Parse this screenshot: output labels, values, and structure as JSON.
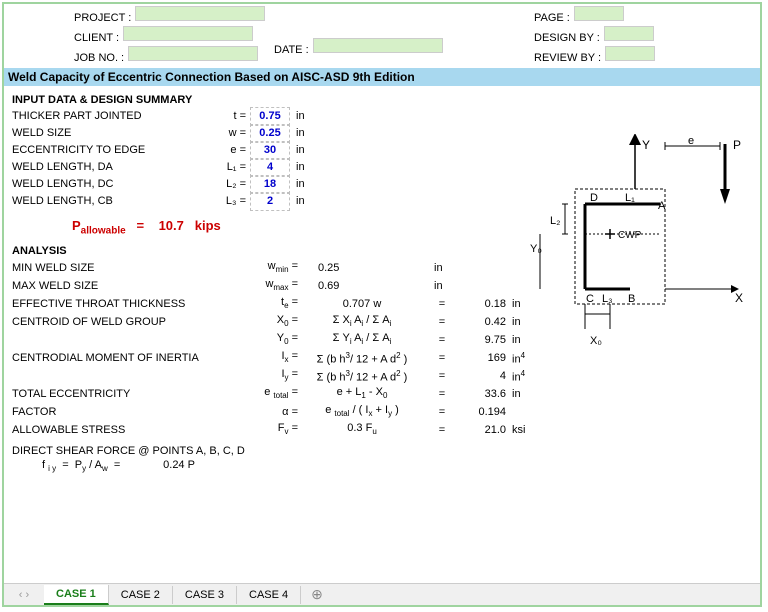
{
  "header": {
    "project_label": "PROJECT :",
    "client_label": "CLIENT :",
    "jobno_label": "JOB NO. :",
    "date_label": "DATE :",
    "page_label": "PAGE :",
    "designby_label": "DESIGN BY :",
    "reviewby_label": "REVIEW BY :"
  },
  "title": "Weld Capacity of Eccentric Connection Based on AISC-ASD 9th Edition",
  "sections": {
    "input_title": "INPUT DATA & DESIGN SUMMARY",
    "analysis_title": "ANALYSIS",
    "shear_title": "DIRECT SHEAR FORCE @ POINTS A, B, C, D"
  },
  "inputs": {
    "thicker": {
      "label": "THICKER PART JOINTED",
      "sym": "t =",
      "val": "0.75",
      "unit": "in"
    },
    "weldsize": {
      "label": "WELD SIZE",
      "sym": "w =",
      "val": "0.25",
      "unit": "in"
    },
    "ecc": {
      "label": "ECCENTRICITY TO EDGE",
      "sym": "e =",
      "val": "30",
      "unit": "in"
    },
    "da": {
      "label": "WELD LENGTH, DA",
      "sym": "L₁ =",
      "val": "4",
      "unit": "in"
    },
    "dc": {
      "label": "WELD LENGTH, DC",
      "sym": "L₂ =",
      "val": "18",
      "unit": "in"
    },
    "cb": {
      "label": "WELD LENGTH, CB",
      "sym": "L₃ =",
      "val": "2",
      "unit": "in"
    }
  },
  "p_allow": {
    "label": "Pallowable",
    "eq": "=",
    "val": "10.7",
    "unit": "kips"
  },
  "analysis": {
    "wmin": {
      "label": "MIN WELD SIZE",
      "sym": "wmin =",
      "val": "0.25",
      "unit": "in"
    },
    "wmax": {
      "label": "MAX WELD SIZE",
      "sym": "wmax =",
      "val": "0.69",
      "unit": "in"
    },
    "te": {
      "label": "EFFECTIVE THROAT THICKNESS",
      "sym": "te =",
      "expr": "0.707 w",
      "val": "0.18",
      "unit": "in"
    },
    "x0": {
      "label": "CENTROID OF WELD GROUP",
      "sym": "X₀ =",
      "expr": "Σ Xi Ai / Σ Ai",
      "val": "0.42",
      "unit": "in"
    },
    "y0": {
      "label": "",
      "sym": "Y₀ =",
      "expr": "Σ Yi Ai / Σ Ai",
      "val": "9.75",
      "unit": "in"
    },
    "ix": {
      "label": "CENTRODIAL MOMENT OF INERTIA",
      "sym": "Ix =",
      "expr": "Σ (b h³/ 12 + A d² )",
      "val": "169",
      "unit": "in⁴"
    },
    "iy": {
      "label": "",
      "sym": "Iy =",
      "expr": "Σ (b h³/ 12 + A d² )",
      "val": "4",
      "unit": "in⁴"
    },
    "etot": {
      "label": "TOTAL ECCENTRICITY",
      "sym": "e total =",
      "expr": "e + L₁ - X₀",
      "val": "33.6",
      "unit": "in"
    },
    "alpha": {
      "label": "FACTOR",
      "sym": "α =",
      "expr": "e total / ( Ix + Iy )",
      "val": "0.194",
      "unit": ""
    },
    "fv": {
      "label": "ALLOWABLE STRESS",
      "sym": "Fv =",
      "expr": "0.3 Fu",
      "val": "21.0",
      "unit": "ksi"
    }
  },
  "shear": {
    "formula": "f i y   =   Py / Aw   =",
    "val": "0.24 P"
  },
  "diagram_labels": {
    "Y": "Y",
    "P": "P",
    "e": "e",
    "D": "D",
    "A": "A",
    "C": "C",
    "B": "B",
    "L1": "L₁",
    "L2": "L₂",
    "L3": "L₃",
    "CWP": "CWP",
    "X": "X",
    "Y0": "Y₀",
    "X0": "X₀"
  },
  "tabs": [
    "CASE 1",
    "CASE 2",
    "CASE 3",
    "CASE 4"
  ]
}
